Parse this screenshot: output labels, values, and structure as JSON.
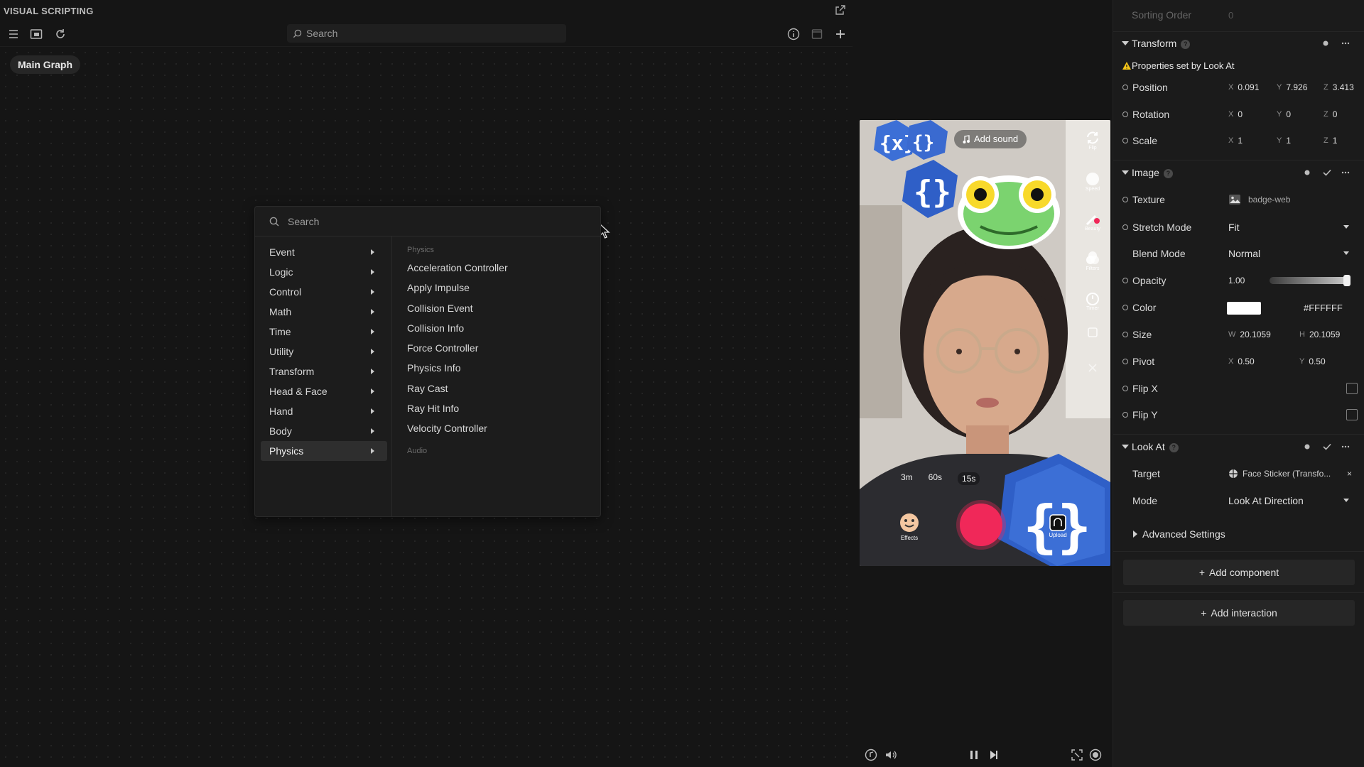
{
  "app": {
    "title": "VISUAL SCRIPTING",
    "search_placeholder": "Search",
    "graph_tab": "Main Graph"
  },
  "picker": {
    "search_placeholder": "Search",
    "categories": [
      "Event",
      "Logic",
      "Control",
      "Math",
      "Time",
      "Utility",
      "Transform",
      "Head & Face",
      "Hand",
      "Body",
      "Physics"
    ],
    "active_category": "Physics",
    "group_label": "Physics",
    "items": [
      "Acceleration Controller",
      "Apply Impulse",
      "Collision Event",
      "Collision Info",
      "Force Controller",
      "Physics Info",
      "Ray Cast",
      "Ray Hit Info",
      "Velocity Controller"
    ],
    "next_group_label": "Audio"
  },
  "preview": {
    "add_sound": "Add sound",
    "side_buttons": [
      "Flip",
      "Speed",
      "Beauty",
      "Filters",
      "Timer",
      "",
      ""
    ],
    "durations": [
      "3m",
      "60s",
      "15s"
    ],
    "selected_duration": "15s",
    "effects_label": "Effects",
    "upload_label": "Upload"
  },
  "inspector": {
    "sorting_order_label": "Sorting Order",
    "sorting_order_value": "0",
    "transform": {
      "title": "Transform",
      "warning": "Properties set by Look At",
      "position": {
        "label": "Position",
        "x": "0.091",
        "y": "7.926",
        "z": "3.413"
      },
      "rotation": {
        "label": "Rotation",
        "x": "0",
        "y": "0",
        "z": "0"
      },
      "scale": {
        "label": "Scale",
        "x": "1",
        "y": "1",
        "z": "1"
      }
    },
    "image": {
      "title": "Image",
      "texture_label": "Texture",
      "texture_value": "badge-web",
      "stretch_label": "Stretch Mode",
      "stretch_value": "Fit",
      "blend_label": "Blend Mode",
      "blend_value": "Normal",
      "opacity_label": "Opacity",
      "opacity_value": "1.00",
      "opacity_level": 1.0,
      "color_label": "Color",
      "color_value": "#FFFFFF",
      "size_label": "Size",
      "size_w": "20.1059",
      "size_h": "20.1059",
      "pivot_label": "Pivot",
      "pivot_x": "0.50",
      "pivot_y": "0.50",
      "flipx_label": "Flip X",
      "flipy_label": "Flip Y"
    },
    "lookat": {
      "title": "Look At",
      "target_label": "Target",
      "target_value": "Face Sticker (Transfo...",
      "mode_label": "Mode",
      "mode_value": "Look At Direction",
      "advanced": "Advanced Settings"
    },
    "add_component": "Add component",
    "add_interaction": "Add interaction",
    "axis_x": "X",
    "axis_y": "Y",
    "axis_z": "Z",
    "axis_w": "W",
    "axis_h": "H"
  }
}
